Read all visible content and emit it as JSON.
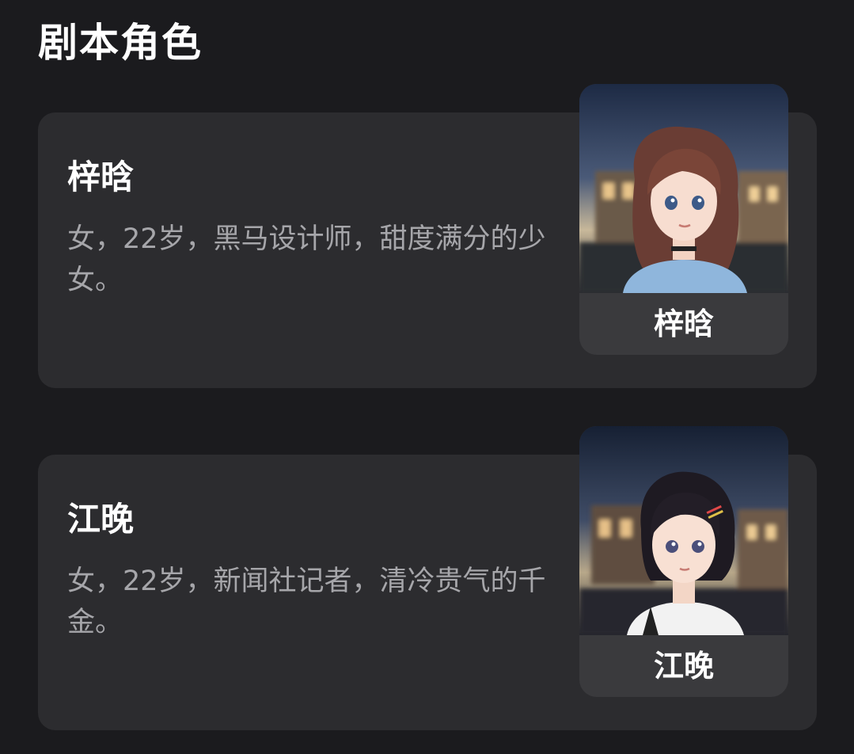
{
  "section": {
    "title": "剧本角色"
  },
  "roles": [
    {
      "name": "梓晗",
      "description": "女，22岁，黑马设计师，甜度满分的少女。",
      "avatar_label": "梓晗"
    },
    {
      "name": "江晚",
      "description": "女，22岁，新闻社记者，清冷贵气的千金。",
      "avatar_label": "江晚"
    }
  ],
  "colors": {
    "background": "#1b1b1e",
    "card": "#2c2c2f",
    "avatar_label_bg": "#3a3a3d",
    "description_text": "#a6a6aa"
  }
}
